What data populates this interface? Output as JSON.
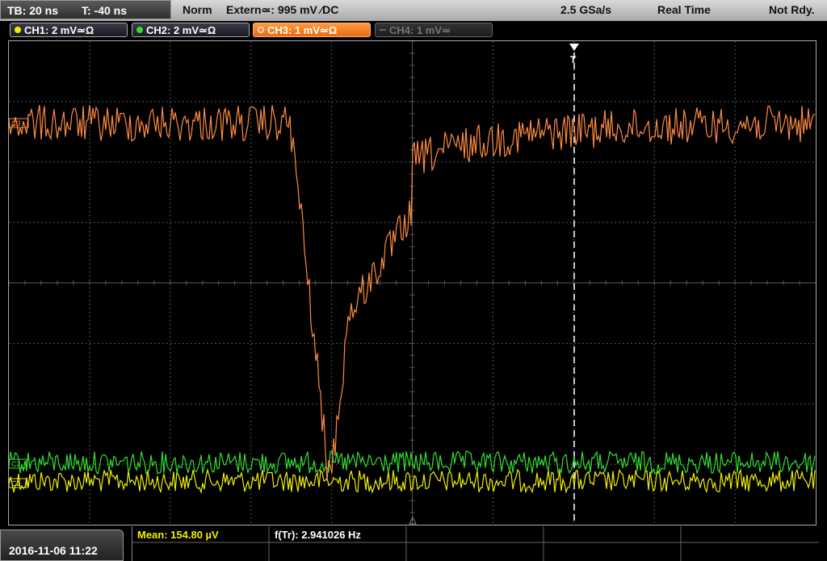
{
  "header": {
    "timebase": "TB: 20 ns",
    "trigger_time": "T: -40 ns",
    "mode": "Norm",
    "trigger_source": "Extern≃: 995 mV ∕DC",
    "sample_rate": "2.5 GSa/s",
    "acq_mode": "Real Time",
    "status": "Not Rdy."
  },
  "channels": [
    {
      "label": "CH1: 2 mV≃Ω",
      "color": "#f0f000",
      "state": "on"
    },
    {
      "label": "CH2: 2 mV≃Ω",
      "color": "#30e030",
      "state": "on"
    },
    {
      "label": "CH3: 1 mV≃Ω",
      "color": "#ff8c40",
      "state": "active"
    },
    {
      "label": "CH4: 1 mV≃",
      "color": "#777777",
      "state": "off"
    }
  ],
  "markers": {
    "ch3": "C3",
    "ch2": "C2",
    "ch1": "C1",
    "trigger": "T"
  },
  "footer": {
    "datetime": "2016-11-06 11:22",
    "mean": "Mean: 154.80 µV",
    "freq": "f(Tr): 2.941026 Hz"
  },
  "colors": {
    "ch1": "#f0f000",
    "ch2": "#30e030",
    "ch3": "#ff8c40",
    "grid": "#555555"
  }
}
